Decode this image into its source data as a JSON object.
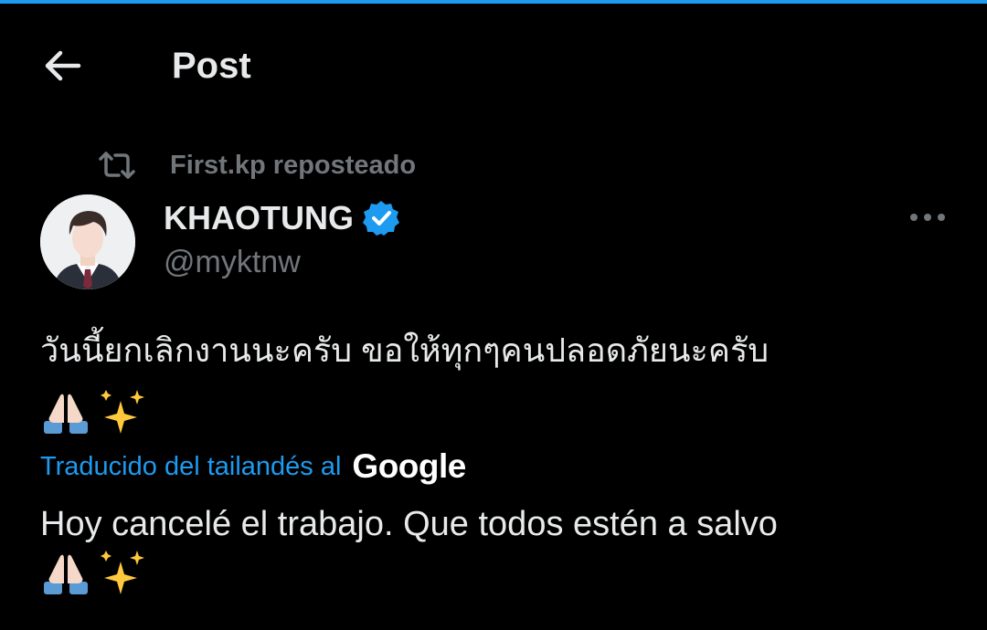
{
  "colors": {
    "background": "#000000",
    "accent": "#1d9bf0",
    "text_primary": "#e7e9ea",
    "text_secondary": "#71767b",
    "verified": "#1d9bf0"
  },
  "header": {
    "back_icon": "arrow-left-icon",
    "title": "Post"
  },
  "repost": {
    "icon": "repost-icon",
    "text": "First.kp reposteado"
  },
  "author": {
    "avatar": "avatar-image",
    "display_name": "KHAOTUNG",
    "verified_icon": "verified-badge-icon",
    "handle": "@myktnw"
  },
  "more_icon": "more-horizontal-icon",
  "post": {
    "text": "วันนี้ยกเลิกงานนะครับ ขอให้ทุกๆคนปลอดภัยนะครับ",
    "emojis": [
      "folded-hands-emoji",
      "sparkles-emoji"
    ]
  },
  "translation": {
    "label": "Traducido del tailandés al",
    "provider": "Google",
    "text": "Hoy cancelé el trabajo. Que todos estén a salvo",
    "emojis": [
      "folded-hands-emoji",
      "sparkles-emoji"
    ]
  }
}
